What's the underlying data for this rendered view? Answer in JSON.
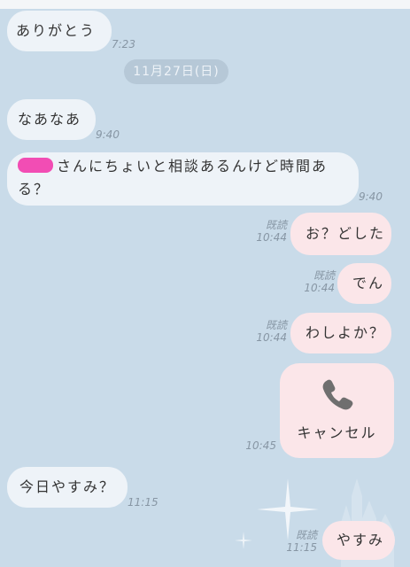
{
  "messages": [
    {
      "text": "ありがとう",
      "time": "7:23"
    },
    {
      "text": "なあなあ",
      "time": "9:40"
    },
    {
      "text": "さんにちょいと相談あるんけど時間ある？",
      "time": "9:40"
    },
    {
      "text": "お？どした",
      "read": "既読",
      "time": "10:44"
    },
    {
      "text": "でん",
      "read": "既読",
      "time": "10:44"
    },
    {
      "text": "わしよか？",
      "read": "既読",
      "time": "10:44"
    },
    {
      "label": "キャンセル",
      "icon": "phone-icon",
      "time": "10:45"
    },
    {
      "text": "今日やすみ？",
      "time": "11:15"
    },
    {
      "text": "やすみ",
      "read": "既読",
      "time": "11:15"
    }
  ],
  "date_separator": "11月27日(日)",
  "colors": {
    "background": "#c9dbe9",
    "incoming_bubble": "#eef3f8",
    "outgoing_bubble": "#fbe6e9",
    "redaction": "#f24db4"
  }
}
